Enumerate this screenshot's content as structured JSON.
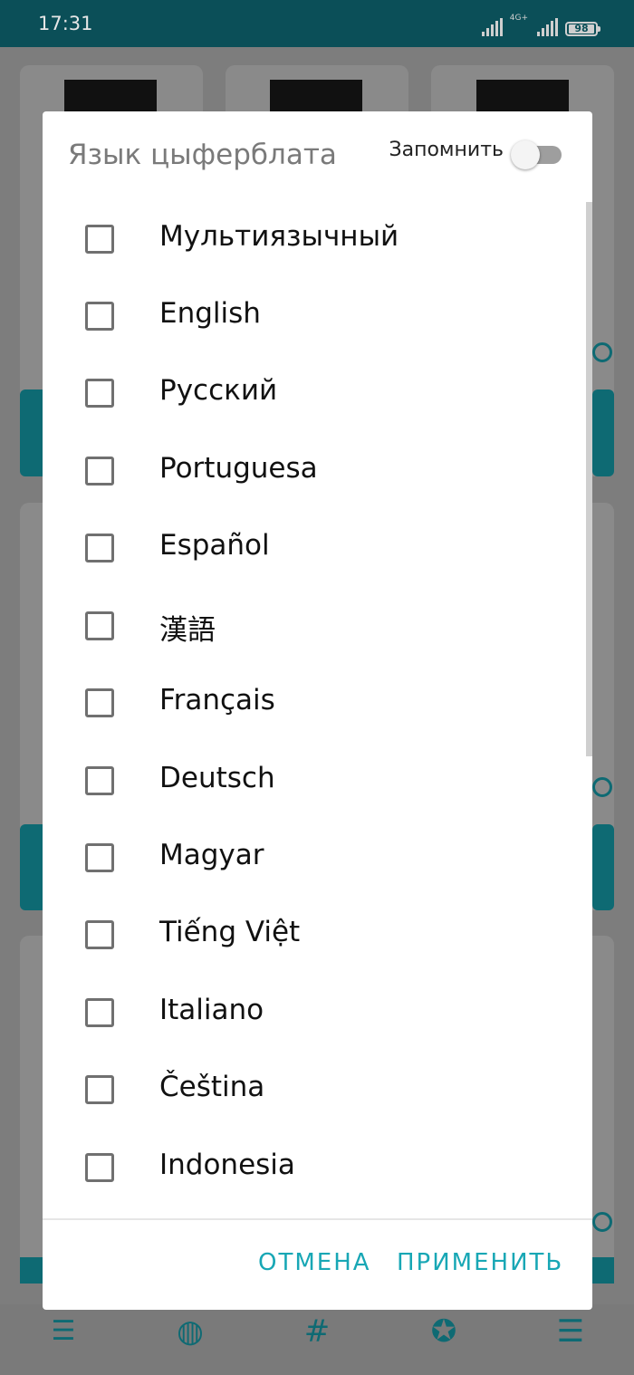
{
  "status_bar": {
    "time": "17:31",
    "network": "4G+",
    "battery": "98"
  },
  "dialog": {
    "title": "Язык цыферблата",
    "remember_label": "Запомнить",
    "remember_checked": false,
    "options": [
      {
        "label": "Мультиязычный",
        "checked": false
      },
      {
        "label": "English",
        "checked": false
      },
      {
        "label": "Русский",
        "checked": false
      },
      {
        "label": "Portuguesa",
        "checked": false
      },
      {
        "label": "Español",
        "checked": false
      },
      {
        "label": "漢語",
        "checked": false
      },
      {
        "label": "Français",
        "checked": false
      },
      {
        "label": "Deutsch",
        "checked": false
      },
      {
        "label": "Magyar",
        "checked": false
      },
      {
        "label": "Tiếng Việt",
        "checked": false
      },
      {
        "label": "Italiano",
        "checked": false
      },
      {
        "label": "Čeština",
        "checked": false
      },
      {
        "label": "Indonesia",
        "checked": false
      }
    ],
    "cancel_label": "ОТМЕНА",
    "apply_label": "ПРИМЕНИТЬ"
  },
  "background": {
    "bottom_nav_icons": [
      "sort-icon",
      "globe-icon",
      "hashtag-icon",
      "star-icon",
      "menu-icon"
    ]
  },
  "colors": {
    "status_bar": "#0b4f58",
    "accent": "#18a7b5",
    "teal_dark": "#0e6a73"
  }
}
